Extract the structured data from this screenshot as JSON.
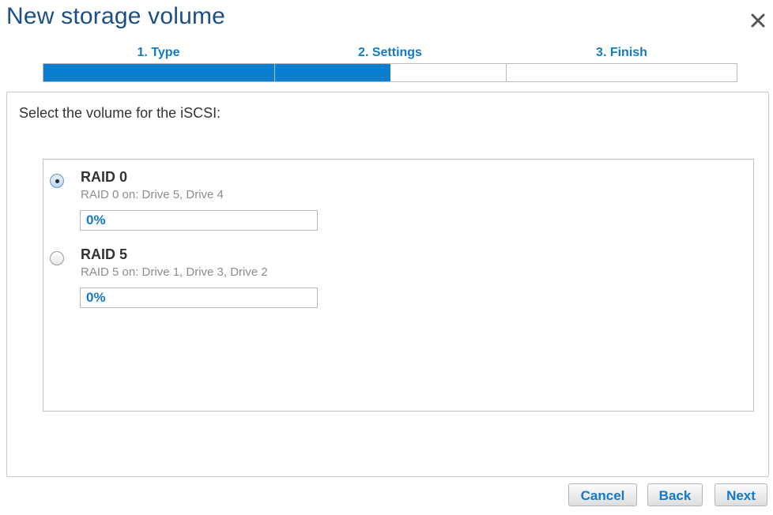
{
  "dialog": {
    "title": "New storage volume",
    "close_icon": "close-icon"
  },
  "wizard": {
    "steps": [
      {
        "label": "1. Type"
      },
      {
        "label": "2. Settings"
      },
      {
        "label": "3. Finish"
      }
    ],
    "progress": {
      "steps_completed": 1,
      "current_step_fraction": 0.5,
      "fill_color": "#0a7fd0"
    }
  },
  "content": {
    "prompt": "Select the volume for the iSCSI:",
    "volumes": [
      {
        "name": "RAID 0",
        "description": "RAID 0 on: Drive 5, Drive 4",
        "usage_text": "0%",
        "usage": 0,
        "selected": true
      },
      {
        "name": "RAID 5",
        "description": "RAID 5 on: Drive 1, Drive 3, Drive 2",
        "usage_text": "0%",
        "usage": 0,
        "selected": false
      }
    ]
  },
  "buttons": {
    "cancel": "Cancel",
    "back": "Back",
    "next": "Next"
  },
  "colors": {
    "title": "#1c4f86",
    "accent": "#1479c6"
  }
}
